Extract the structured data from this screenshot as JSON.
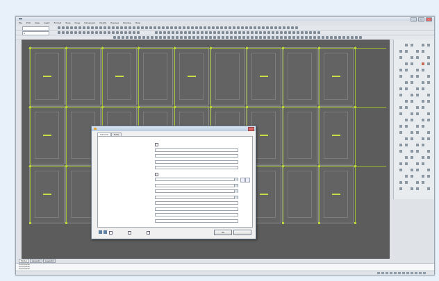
{
  "window": {
    "title": "",
    "buttons": [
      "_",
      "□",
      "x"
    ]
  },
  "menubar": {
    "items": [
      "File",
      "Edit",
      "View",
      "Insert",
      "Format",
      "Tools",
      "Draw",
      "Dimension",
      "Modify",
      "Express",
      "Window",
      "Help"
    ]
  },
  "toolbar": {
    "layer_value": "0"
  },
  "drawing": {
    "tab_labels": [
      "Model",
      "Layout1",
      "Layout2"
    ],
    "active_tab": "Model"
  },
  "command_line": {
    "lines": [
      "Command:",
      "Command:",
      "Command:"
    ]
  },
  "status_bar": {
    "coordinates": ""
  },
  "dialog": {
    "title": "",
    "tabs": [
      "General",
      "Data"
    ],
    "active_tab": "General",
    "properties": [
      {
        "label": "",
        "kind": "check"
      },
      {
        "label": "",
        "kind": "field"
      },
      {
        "label": "",
        "kind": "field"
      },
      {
        "label": "",
        "kind": "field"
      },
      {
        "label": "",
        "kind": "field"
      },
      {
        "label": "",
        "kind": "check"
      },
      {
        "label": "",
        "kind": "combo"
      },
      {
        "label": "",
        "kind": "combo"
      },
      {
        "label": "",
        "kind": "combo"
      },
      {
        "label": "",
        "kind": "combo"
      },
      {
        "label": "",
        "kind": "field"
      },
      {
        "label": "",
        "kind": "field"
      },
      {
        "label": "",
        "kind": "field"
      },
      {
        "label": "",
        "kind": "field"
      }
    ],
    "footer": {
      "check1_label": "",
      "check2_label": "",
      "check3_label": "",
      "ok_label": "OK",
      "cancel_label": ""
    }
  },
  "colors": {
    "canvas": "#5c5c5c",
    "accent": "#b8d43a",
    "desktop": "#e8f1f9"
  }
}
